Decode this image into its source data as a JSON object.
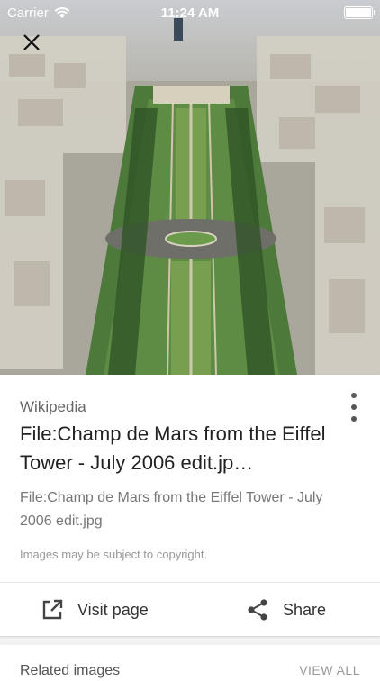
{
  "status_bar": {
    "carrier": "Carrier",
    "time": "11:24 AM"
  },
  "image": {
    "icon": "photo-image"
  },
  "card": {
    "source": "Wikipedia",
    "title": "File:Champ de Mars from the Eiffel Tower - July 2006 edit.jp…",
    "subtitle": "File:Champ de Mars from the Eiffel Tower - July 2006 edit.jpg",
    "copyright": "Images may be subject to copyright.",
    "visit_label": "Visit page",
    "share_label": "Share"
  },
  "related": {
    "label": "Related images",
    "view_all": "VIEW ALL"
  }
}
